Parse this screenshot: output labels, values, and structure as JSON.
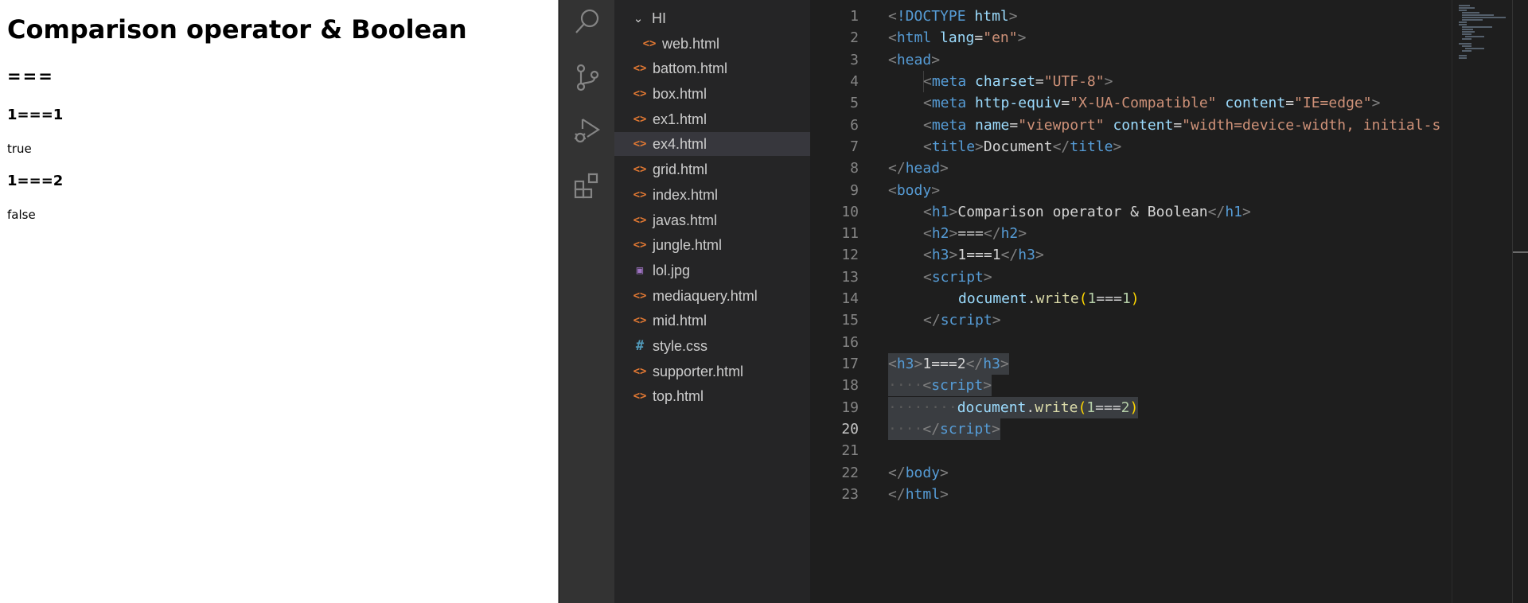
{
  "preview": {
    "h1": "Comparison operator & Boolean",
    "h2": "===",
    "h3_a": "1===1",
    "result_a": "true",
    "h3_b": "1===2",
    "result_b": "false"
  },
  "activity_bar": [
    "search-icon",
    "source-control-icon",
    "run-debug-icon",
    "extensions-icon"
  ],
  "explorer": {
    "folder": "HI",
    "files": [
      "web.html",
      "battom.html",
      "box.html",
      "ex1.html",
      "ex4.html",
      "grid.html",
      "index.html",
      "javas.html",
      "jungle.html",
      "lol.jpg",
      "mediaquery.html",
      "mid.html",
      "style.css",
      "supporter.html",
      "top.html"
    ],
    "selected": "ex4.html"
  },
  "editor": {
    "line_numbers": [
      "1",
      "2",
      "3",
      "4",
      "5",
      "6",
      "7",
      "8",
      "9",
      "10",
      "11",
      "12",
      "13",
      "14",
      "15",
      "16",
      "17",
      "18",
      "19",
      "20",
      "21",
      "22",
      "23"
    ],
    "active_line": "20",
    "lines": {
      "l1": {
        "br1": "<",
        "kw": "!DOCTYPE",
        "sp": " ",
        "tag": "html",
        "br2": ">"
      },
      "l2": {
        "br1": "<",
        "tag": "html",
        "sp": " ",
        "attr": "lang",
        "eq": "=",
        "val": "\"en\"",
        "br2": ">"
      },
      "l3": {
        "br1": "<",
        "tag": "head",
        "br2": ">"
      },
      "l4": {
        "br1": "<",
        "tag": "meta",
        "sp": " ",
        "attr": "charset",
        "eq": "=",
        "val": "\"UTF-8\"",
        "br2": ">"
      },
      "l5": {
        "br1": "<",
        "tag": "meta",
        "sp": " ",
        "attr1": "http-equiv",
        "eq1": "=",
        "val1": "\"X-UA-Compatible\"",
        "sp2": " ",
        "attr2": "content",
        "eq2": "=",
        "val2": "\"IE=edge\"",
        "br2": ">"
      },
      "l6": {
        "br1": "<",
        "tag": "meta",
        "sp": " ",
        "attr1": "name",
        "eq1": "=",
        "val1": "\"viewport\"",
        "sp2": " ",
        "attr2": "content",
        "eq2": "=",
        "val2": "\"width=device-width, initial-s"
      },
      "l7": {
        "br1": "<",
        "tag": "title",
        "br2": ">",
        "text": "Document",
        "br3": "</",
        "tag2": "title",
        "br4": ">"
      },
      "l8": {
        "br1": "</",
        "tag": "head",
        "br2": ">"
      },
      "l9": {
        "br1": "<",
        "tag": "body",
        "br2": ">"
      },
      "l10": {
        "br1": "<",
        "tag": "h1",
        "br2": ">",
        "text": "Comparison operator & Boolean",
        "br3": "</",
        "tag2": "h1",
        "br4": ">"
      },
      "l11": {
        "br1": "<",
        "tag": "h2",
        "br2": ">",
        "text": "===",
        "br3": "</",
        "tag2": "h2",
        "br4": ">"
      },
      "l12": {
        "br1": "<",
        "tag": "h3",
        "br2": ">",
        "text": "1===1",
        "br3": "</",
        "tag2": "h3",
        "br4": ">"
      },
      "l13": {
        "br1": "<",
        "tag": "script",
        "br2": ">"
      },
      "l14": {
        "obj": "document",
        "dot": ".",
        "fn": "write",
        "p1": "(",
        "n1": "1",
        "op": "===",
        "n2": "1",
        "p2": ")"
      },
      "l15": {
        "br1": "</",
        "tag": "script",
        "br2": ">"
      },
      "l17": {
        "br1": "<",
        "tag": "h3",
        "br2": ">",
        "text": "1===2",
        "br3": "</",
        "tag2": "h3",
        "br4": ">"
      },
      "l18": {
        "ws": "····",
        "br1": "<",
        "tag": "script",
        "br2": ">"
      },
      "l19": {
        "ws": "········",
        "obj": "document",
        "dot": ".",
        "fn": "write",
        "p1": "(",
        "n1": "1",
        "op": "===",
        "n2": "2",
        "p2": ")"
      },
      "l20": {
        "ws": "····",
        "br1": "</",
        "tag": "script",
        "br2": ">"
      },
      "l22": {
        "br1": "</",
        "tag": "body",
        "br2": ">"
      },
      "l23": {
        "br1": "</",
        "tag": "html",
        "br2": ">"
      }
    }
  }
}
